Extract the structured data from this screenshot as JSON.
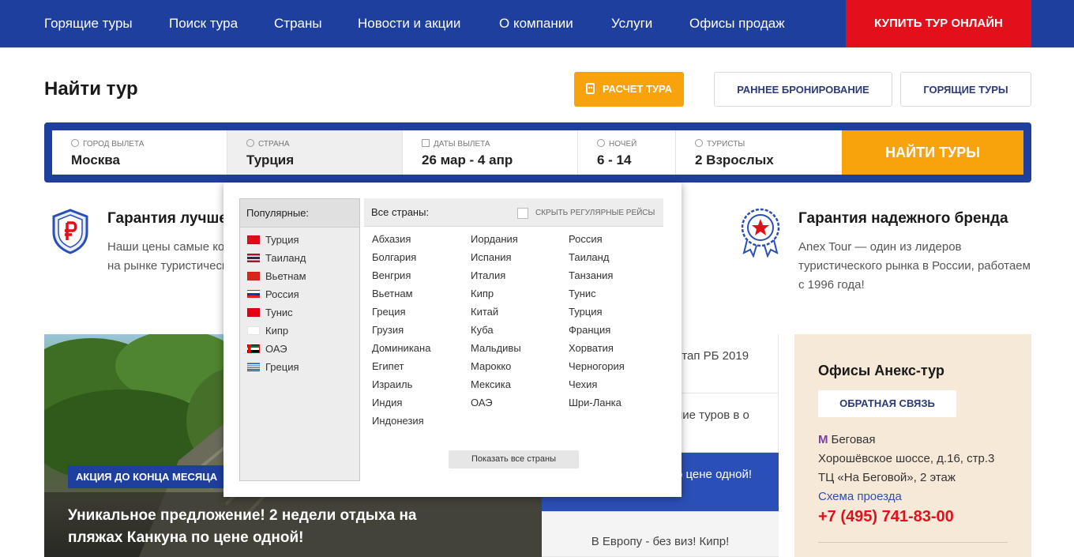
{
  "nav": {
    "items": [
      "Горящие туры",
      "Поиск тура",
      "Страны",
      "Новости и акции",
      "О компании",
      "Услуги",
      "Офисы продаж"
    ],
    "buy_label": "КУПИТЬ ТУР ОНЛАЙН"
  },
  "page": {
    "title": "Найти тур",
    "calc_label": "РАСЧЕТ ТУРА",
    "early_label": "РАННЕЕ БРОНИРОВАНИЕ",
    "hot_label": "ГОРЯЩИЕ ТУРЫ"
  },
  "search": {
    "city_label": "ГОРОД ВЫЛЕТА",
    "city_value": "Москва",
    "country_label": "СТРАНА",
    "country_value": "Турция",
    "dates_label": "ДАТЫ ВЫЛЕТА",
    "dates_value": "26 мар - 4 апр",
    "nights_label": "НОЧЕЙ",
    "nights_value": "6 - 14",
    "tourists_label": "ТУРИСТЫ",
    "tourists_value": "2 Взрослых",
    "find_label": "НАЙТИ ТУРЫ"
  },
  "guarantee1": {
    "title": "Гарантия лучше",
    "line1": "Наши цены самые ко",
    "line2": "на рынке туристическ"
  },
  "guarantee2": {
    "title": "Гарантия надежного бренда",
    "line1": "Anex Tour — один из лидеров",
    "line2": "туристического рынка в России, работаем",
    "line3": "с 1996 года!"
  },
  "promo": {
    "tag": "АКЦИЯ ДО КОНЦА МЕСЯЦА",
    "text": "Уникальное предложение! 2 недели отдыха на пляжах Канкуна по цене одной!"
  },
  "news": [
    "этап РБ 2019",
    "ние туров в о",
    "о цене одной!",
    "В Европу - без виз! Кипр!"
  ],
  "offices": {
    "title": "Офисы Анекс-тур",
    "feedback_label": "ОБРАТНАЯ СВЯЗЬ",
    "metro_symbol": "М",
    "metro": "Беговая",
    "address1": "Хорошёвское шоссе, д.16, стр.3",
    "address2": "ТЦ «На Беговой», 2 этаж",
    "map_link": "Схема проезда",
    "phone": "+7 (495) 741-83-00"
  },
  "dropdown": {
    "popular_header": "Популярные:",
    "popular": [
      {
        "name": "Турция",
        "flag": "turkey"
      },
      {
        "name": "Таиланд",
        "flag": "thailand"
      },
      {
        "name": "Вьетнам",
        "flag": "vietnam"
      },
      {
        "name": "Россия",
        "flag": "russia"
      },
      {
        "name": "Тунис",
        "flag": "tunisia"
      },
      {
        "name": "Кипр",
        "flag": "cyprus"
      },
      {
        "name": "ОАЭ",
        "flag": "uae"
      },
      {
        "name": "Греция",
        "flag": "greece"
      }
    ],
    "all_header": "Все страны:",
    "hide_regular": "СКРЫТЬ РЕГУЛЯРНЫЕ РЕЙСЫ",
    "col1": [
      "Абхазия",
      "Болгария",
      "Венгрия",
      "Вьетнам",
      "Греция",
      "Грузия",
      "Доминикана",
      "Египет",
      "Израиль",
      "Индия",
      "Индонезия"
    ],
    "col2": [
      "Иордания",
      "Испания",
      "Италия",
      "Кипр",
      "Китай",
      "Куба",
      "Мальдивы",
      "Марокко",
      "Мексика",
      "ОАЭ"
    ],
    "col3": [
      "Россия",
      "Таиланд",
      "Танзания",
      "Тунис",
      "Турция",
      "Франция",
      "Хорватия",
      "Черногория",
      "Чехия",
      "Шри-Ланка"
    ],
    "show_all": "Показать все страны"
  },
  "colors": {
    "brand_blue": "#1f3f9f",
    "accent_orange": "#f8a30c",
    "buy_red": "#e3101b"
  }
}
